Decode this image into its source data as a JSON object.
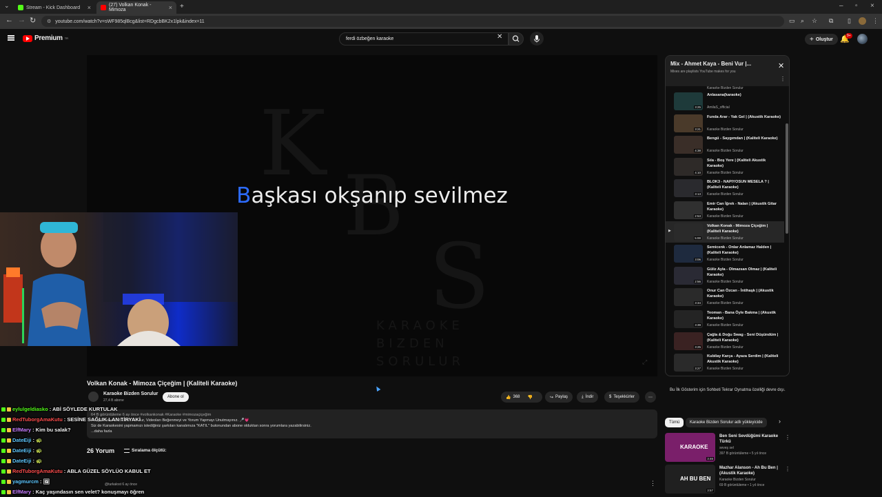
{
  "browser": {
    "tabs": [
      {
        "label": "Stream - Kick Dashboard",
        "favicon_color": "#53fc18"
      },
      {
        "label": "(27) Volkan Konak - Mimoza",
        "favicon_color": "#ff0000"
      }
    ],
    "url": "youtube.com/watch?v=sWF985qlBcg&list=RDgcbBK2x1lpk&index=11"
  },
  "header": {
    "logo": "Premium",
    "logo_sup": "TR",
    "search_value": "ferdi özbeğen karaoke",
    "create_label": "Oluştur",
    "notifications": "9+"
  },
  "video": {
    "lyric_first": "B",
    "lyric_rest": "aşkası okşanıp sevilmez",
    "bg_letters": [
      "K",
      "B",
      "S"
    ],
    "bg_sub": [
      "KARAOKE",
      "BIZDEN",
      "SORULUR"
    ],
    "title": "Volkan Konak - Mimoza Çiçeğim | (Kaliteli Karaoke)",
    "channel": "Karaoke Bizden Sorulur",
    "subs": "27,4 B abone",
    "subscribe": "Abone ol",
    "likes": "368",
    "share": "Paylaş",
    "download": "İndir",
    "thanks": "Teşekkürler"
  },
  "description": {
    "meta": "64 B görüntüleme  6 ay önce  #volkankonak #Karaoke #mimozaçiçeğim",
    "line1": "Sevgili Karaoke Bizden Sorulur, Videoları Beğenmeyi ve Yorum Yapmayı Unutmayınız. 🎤💗",
    "line2": "Siz de Karaokesini yapmamızı istediğiniz şarkıları kanalımıza \"KATIL\" butonundan abone olduktan sonra yorumlara yazabilirsiniz.",
    "more": "...daha fazla"
  },
  "comments": {
    "count": "26 Yorum",
    "sort": "Sıralama ölçütü:",
    "first_user": "@turkalost  6 ay önce"
  },
  "chat": [
    {
      "user": "eylulgeldiasko",
      "color": "#53fc18",
      "msg": ": ABİ SÖYLEDE KURTULAK"
    },
    {
      "user": "RedTuborgAmaKutu",
      "color": "#ff4d4d",
      "msg": ": SESİNE SAĞLIK LAN TİRYAKİ"
    },
    {
      "user": "ElfMary",
      "color": "#c77dff",
      "msg": ": Kim bu salak?"
    },
    {
      "user": "DateEiji",
      "color": "#5ec8ff",
      "msg": ": 🐢"
    },
    {
      "user": "DateEiji",
      "color": "#5ec8ff",
      "msg": ": 🐢"
    },
    {
      "user": "DateEiji",
      "color": "#5ec8ff",
      "msg": ": 🐢"
    },
    {
      "user": "RedTuborgAmaKutu",
      "color": "#ff4d4d",
      "msg": ": ABLA GÜZEL SÖYLÜO KABUL ET"
    },
    {
      "user": "yagmurcm",
      "color": "#5ec8ff",
      "msg": ": 🖼"
    },
    {
      "user": "ElfMary",
      "color": "#c77dff",
      "msg": ": Kaç yaşındasın sen velet? konuşmayı öğren"
    }
  ],
  "playlist": {
    "title": "Mix - Ahmet Kaya - Beni Vur |...",
    "subtitle": "Mixes are playlists YouTube makes for you",
    "top_channel": "Karaoke Bizden Sorulur",
    "items": [
      {
        "title": "Anlasana(karaoke)",
        "channel": "AmilaS_official",
        "dur": "3:25",
        "active": false,
        "thumb": "#1e3a3a"
      },
      {
        "title": "Funda Arar - Yak Gel | (Akustik Karaoke)",
        "channel": "Karaoke Bizden Sorulur",
        "dur": "3:21",
        "active": false,
        "thumb": "#4a3a2a"
      },
      {
        "title": "Bengü - Saygımdan | (Kaliteli Karaoke)",
        "channel": "Karaoke Bizden Sorulur",
        "dur": "4:38",
        "active": false,
        "thumb": "#3a2e28"
      },
      {
        "title": "Sıla - Boş Yere | (Kaliteli Akustik Karaoke)",
        "channel": "Karaoke Bizden Sorulur",
        "dur": "4:10",
        "active": false,
        "thumb": "#2e2a28"
      },
      {
        "title": "BLOK3 - NAPIYOSUN MESELA ? | (Kaliteli Karaoke)",
        "channel": "Karaoke Bizden Sorulur",
        "dur": "3:13",
        "active": false,
        "thumb": "#2a2a2e"
      },
      {
        "title": "Emir Can İğrek - Nalan | (Akustik Gitar Karaoke)",
        "channel": "Karaoke Bizden Sorulur",
        "dur": "2:53",
        "active": false,
        "thumb": "#303030"
      },
      {
        "title": "Volkan Konak - Mimoza Çiçeğim | (Kaliteli Karaoke)",
        "channel": "Karaoke Bizden Sorulur",
        "dur": "5:00",
        "active": true,
        "thumb": "#2a2a2a"
      },
      {
        "title": "Semicenk - Onlar Anlamaz Halden | (Kaliteli Karaoke)",
        "channel": "Karaoke Bizden Sorulur",
        "dur": "3:06",
        "active": false,
        "thumb": "#1e2a3e"
      },
      {
        "title": "Güliz Ayla - Olmazsan Olmaz | (Kaliteli Karaoke)",
        "channel": "Karaoke Bizden Sorulur",
        "dur": "2:56",
        "active": false,
        "thumb": "#2a2a34"
      },
      {
        "title": "Onur Can Özcan - İntihaşk | (Akustik Karaoke)",
        "channel": "Karaoke Bizden Sorulur",
        "dur": "3:34",
        "active": false,
        "thumb": "#2a2a2a"
      },
      {
        "title": "Teoman - Bana Öyle Bakma | (Akustik Karaoke)",
        "channel": "Karaoke Bizden Sorulur",
        "dur": "3:39",
        "active": false,
        "thumb": "#242424"
      },
      {
        "title": "Çağla & Doğu Swag - Seni Düşündüm | (Kaliteli Karaoke)",
        "channel": "Karaoke Bizden Sorulur",
        "dur": "3:25",
        "active": false,
        "thumb": "#3a2222"
      },
      {
        "title": "Kubilay Karça - Ayaza Serdim | (Kaliteli Akustik Karaoke)",
        "channel": "Karaoke Bizden Sorulur",
        "dur": "3:27",
        "active": false,
        "thumb": "#2a2a2a"
      }
    ]
  },
  "sidebar": {
    "note": "Bu İlk Gösterim için Sohbeti Tekrar Oynatma özelliği devre dışı.",
    "chip_all": "Tümü",
    "chip_channel": "Karaoke Bizden Sorulur adlı yükleyicide",
    "recs": [
      {
        "title": "Ben Seni Sevdüğümi Karaoke Türkü",
        "channel": "seveş sel",
        "meta": "397 B görüntüleme • 5 yıl önce",
        "dur": "3:46",
        "thumb": "#7a1f6a",
        "thumb_text": "KARAOKE"
      },
      {
        "title": "Mazhar Alanson - Ah Bu Ben | (Akustik Karaoke)",
        "channel": "Karaoke Bizden Sorulur",
        "meta": "69 B görüntüleme • 1 yıl önce",
        "dur": "3:57",
        "thumb": "#202020",
        "thumb_text": "AH BU BEN"
      }
    ]
  }
}
